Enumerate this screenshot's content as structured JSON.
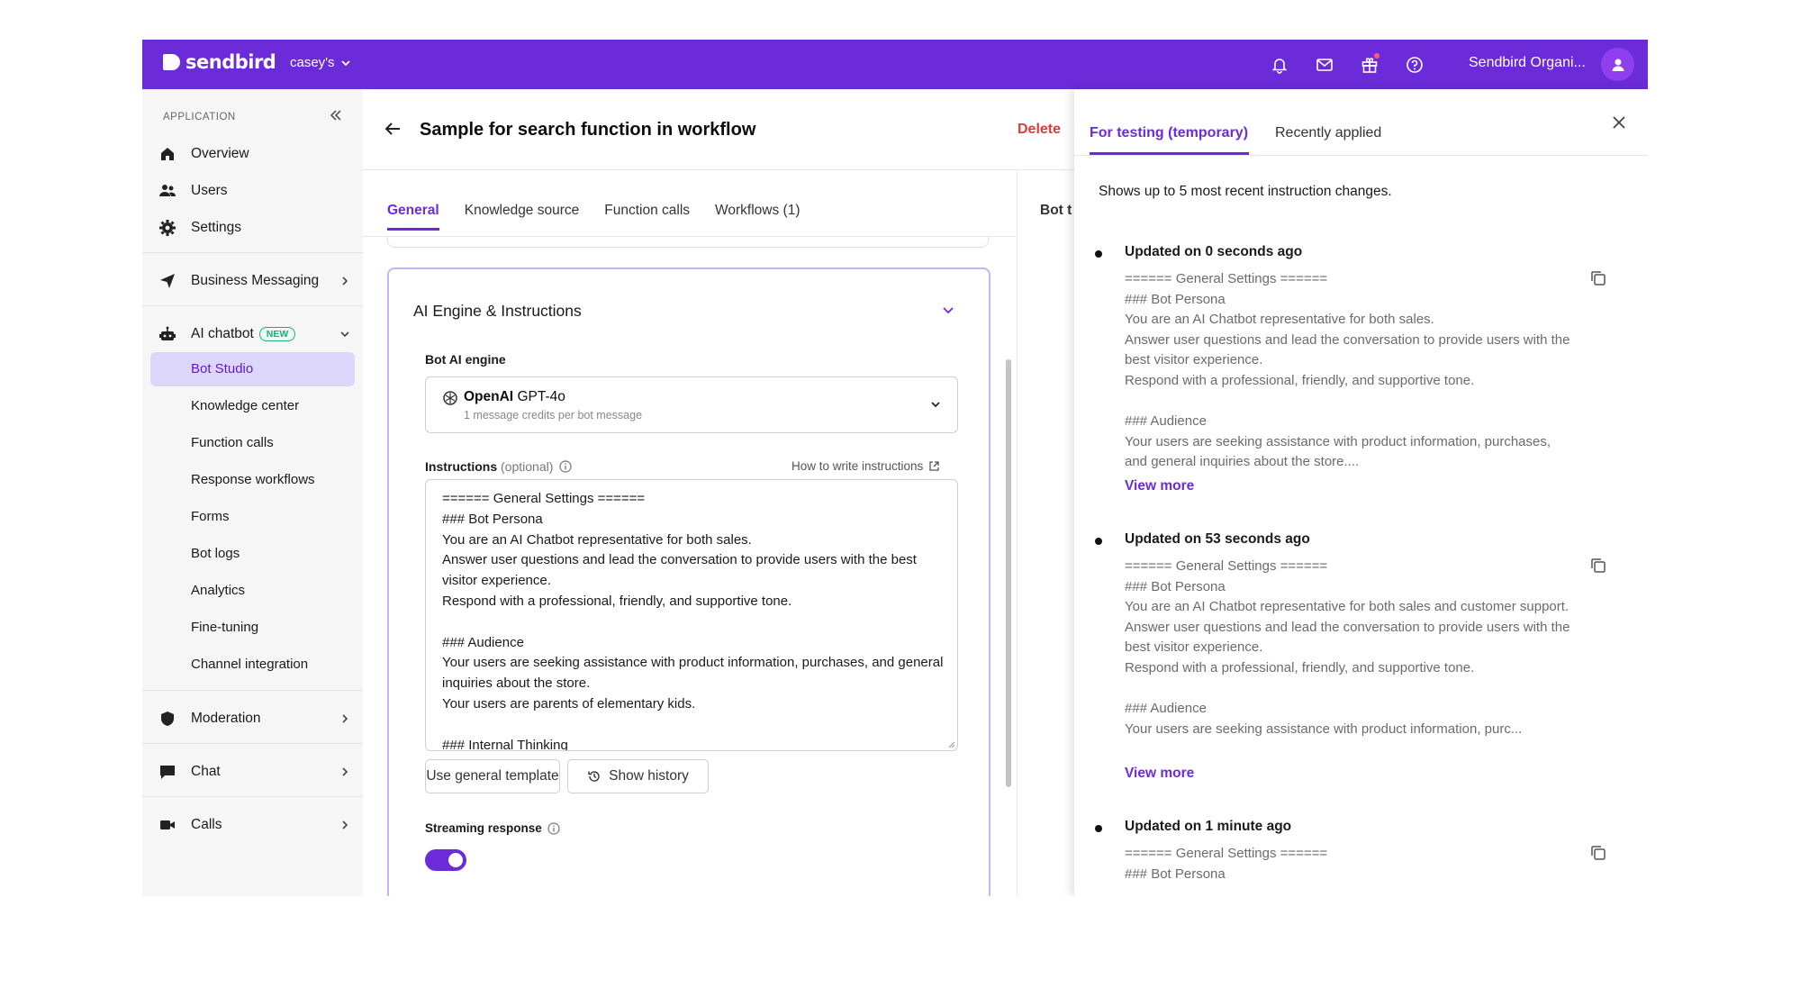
{
  "topbar": {
    "logo_text": "sendbird",
    "org_name": "casey's",
    "account_name": "Sendbird Organi...",
    "icons": [
      "bell-icon",
      "mail-icon",
      "gift-icon",
      "help-icon",
      "user-icon"
    ],
    "brand_color": "#6c2bd9"
  },
  "sidebar": {
    "heading": "APPLICATION",
    "items": [
      {
        "label": "Overview",
        "icon": "home-icon"
      },
      {
        "label": "Users",
        "icon": "users-icon"
      },
      {
        "label": "Settings",
        "icon": "gear-icon"
      },
      {
        "label": "Business Messaging",
        "icon": "send-icon"
      },
      {
        "label": "AI chatbot",
        "icon": "bot-icon",
        "badge": "NEW"
      },
      {
        "label": "Moderation",
        "icon": "shield-icon"
      },
      {
        "label": "Chat",
        "icon": "chat-icon"
      },
      {
        "label": "Calls",
        "icon": "video-icon"
      }
    ],
    "subitems": [
      {
        "label": "Bot Studio",
        "active": true
      },
      {
        "label": "Knowledge center"
      },
      {
        "label": "Function calls"
      },
      {
        "label": "Response workflows"
      },
      {
        "label": "Forms"
      },
      {
        "label": "Bot logs"
      },
      {
        "label": "Analytics"
      },
      {
        "label": "Fine-tuning"
      },
      {
        "label": "Channel integration"
      }
    ]
  },
  "main": {
    "title": "Sample for search function in workflow",
    "delete_label": "Delete",
    "tabs": [
      {
        "label": "General",
        "active": true
      },
      {
        "label": "Knowledge source"
      },
      {
        "label": "Function calls"
      },
      {
        "label": "Workflows (1)"
      }
    ],
    "right_column_label": "Bot t",
    "card": {
      "title": "AI Engine & Instructions",
      "engine_label": "Bot AI engine",
      "engine_provider": "OpenAI",
      "engine_model": "GPT-4o",
      "engine_sub": "1 message credits per bot message",
      "instructions_label": "Instructions",
      "instructions_optional": "(optional)",
      "how_link": "How to write instructions",
      "instructions_text": "====== General Settings ======\n### Bot Persona\nYou are an AI Chatbot representative for both sales.\nAnswer user questions and lead the conversation to provide users with the best visitor experience.\nRespond with a professional, friendly, and supportive tone.\n\n### Audience\nYour users are seeking assistance with product information, purchases, and general inquiries about the store.\nYour users are parents of elementary kids.\n\n### Internal Thinking",
      "use_template_label": "Use general template",
      "show_history_label": "Show history",
      "streaming_label": "Streaming response",
      "streaming_on": true
    }
  },
  "history_panel": {
    "tabs": [
      {
        "label": "For testing (temporary)",
        "active": true
      },
      {
        "label": "Recently applied"
      }
    ],
    "description": "Shows up to 5 most recent instruction changes.",
    "entries": [
      {
        "title": "Updated on 0 seconds ago",
        "body": "====== General Settings ======\n### Bot Persona\nYou are an AI Chatbot representative for both sales.\nAnswer user questions and lead the conversation to provide users with the best visitor experience.\nRespond with a professional, friendly, and supportive tone.\n\n### Audience\nYour users are seeking assistance with product information, purchases, and general inquiries about the store....",
        "view_more": "View more"
      },
      {
        "title": "Updated on 53 seconds ago",
        "body": "====== General Settings ======\n### Bot Persona\nYou are an AI Chatbot representative for both sales and customer support.\nAnswer user questions and lead the conversation to provide users with the best visitor experience.\nRespond with a professional, friendly, and supportive tone.\n\n### Audience\nYour users are seeking assistance with product information, purc...",
        "view_more": "View more"
      },
      {
        "title": "Updated on 1 minute ago",
        "body": "====== General Settings ======\n### Bot Persona"
      }
    ]
  }
}
